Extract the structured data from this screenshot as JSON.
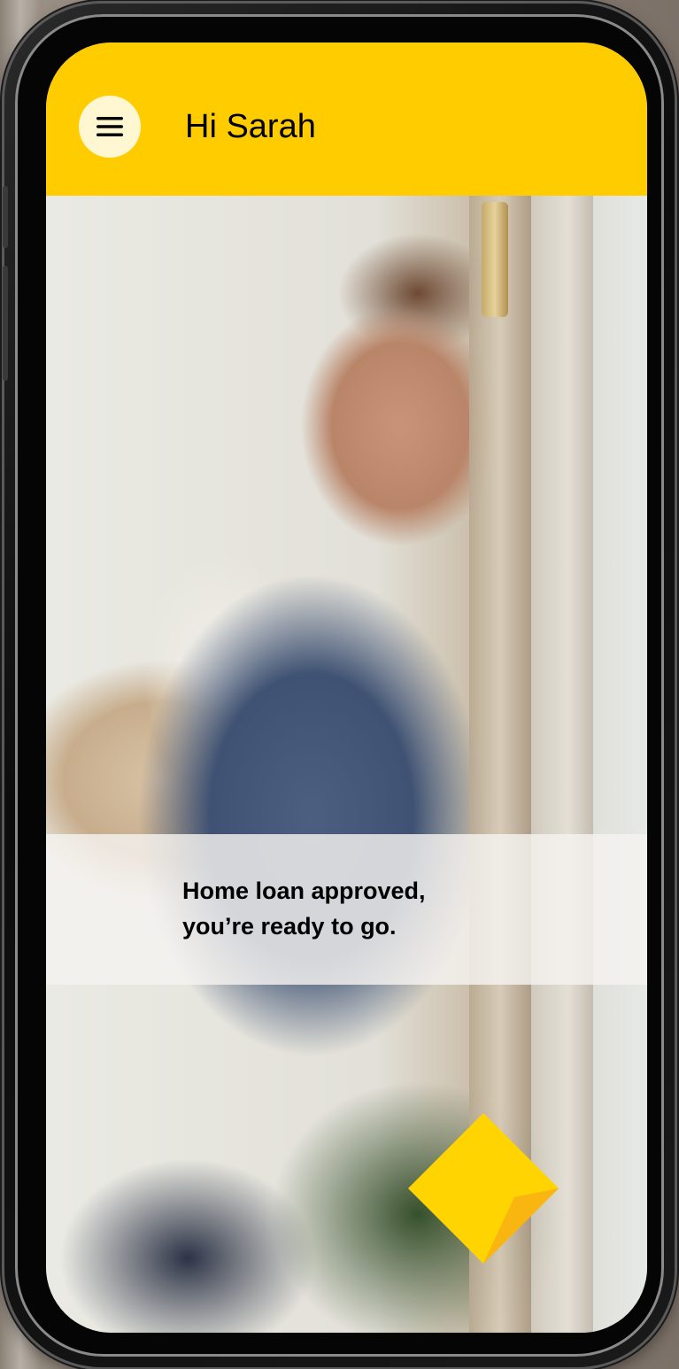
{
  "header": {
    "greeting": "Hi Sarah",
    "menu_icon": "hamburger-menu-icon",
    "background_color": "#ffcc00"
  },
  "banner": {
    "line1": "Home loan approved,",
    "line2": "you’re ready to go."
  },
  "logo": {
    "name": "commbank-diamond-logo-icon",
    "primary_color": "#ffd400",
    "fold_color": "#f0a800"
  }
}
